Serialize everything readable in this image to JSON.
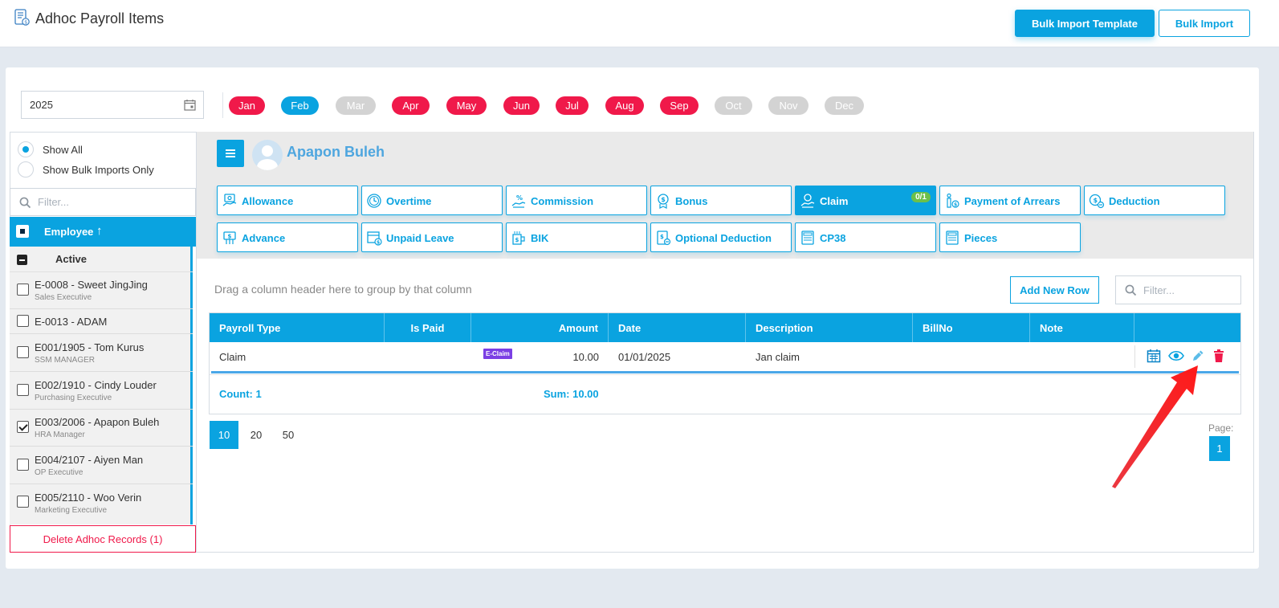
{
  "header": {
    "title": "Adhoc Payroll Items",
    "bulk_template_label": "Bulk Import Template",
    "bulk_import_label": "Bulk Import"
  },
  "year": {
    "value": "2025"
  },
  "months": [
    {
      "label": "Jan",
      "state": "red"
    },
    {
      "label": "Feb",
      "state": "blue"
    },
    {
      "label": "Mar",
      "state": "gray"
    },
    {
      "label": "Apr",
      "state": "red"
    },
    {
      "label": "May",
      "state": "red"
    },
    {
      "label": "Jun",
      "state": "red"
    },
    {
      "label": "Jul",
      "state": "red"
    },
    {
      "label": "Aug",
      "state": "red"
    },
    {
      "label": "Sep",
      "state": "red"
    },
    {
      "label": "Oct",
      "state": "gray"
    },
    {
      "label": "Nov",
      "state": "gray"
    },
    {
      "label": "Dec",
      "state": "gray"
    }
  ],
  "sidebar": {
    "show_all": "Show All",
    "show_bulk": "Show Bulk Imports Only",
    "filter_placeholder": "Filter...",
    "column_header": "Employee",
    "sort_arrow": "↑",
    "group_label": "Active",
    "employees": [
      {
        "name": "E-0008 - Sweet JingJing",
        "role": "Sales Executive",
        "checked": false
      },
      {
        "name": "E-0013 - ADAM",
        "role": "",
        "checked": false
      },
      {
        "name": "E001/1905 - Tom Kurus",
        "role": "SSM MANAGER",
        "checked": false
      },
      {
        "name": "E002/1910 - Cindy Louder",
        "role": "Purchasing Executive",
        "checked": false
      },
      {
        "name": "E003/2006 - Apapon Buleh",
        "role": "HRA Manager",
        "checked": true
      },
      {
        "name": "E004/2107 - Aiyen Man",
        "role": "OP Executive",
        "checked": false
      },
      {
        "name": "E005/2110 - Woo Verin",
        "role": "Marketing Executive",
        "checked": false
      }
    ],
    "delete_label": "Delete Adhoc Records (1)"
  },
  "main": {
    "employee_name": "Apapon Buleh",
    "categories_row1": [
      {
        "label": "Allowance",
        "icon": "allowance-icon"
      },
      {
        "label": "Overtime",
        "icon": "overtime-icon"
      },
      {
        "label": "Commission",
        "icon": "commission-icon"
      },
      {
        "label": "Bonus",
        "icon": "bonus-icon"
      },
      {
        "label": "Claim",
        "icon": "claim-icon",
        "badge": "0/1",
        "active": true
      },
      {
        "label": "Payment of Arrears",
        "icon": "arrears-icon"
      },
      {
        "label": "Deduction",
        "icon": "deduction-icon"
      }
    ],
    "categories_row2": [
      {
        "label": "Advance",
        "icon": "advance-icon"
      },
      {
        "label": "Unpaid Leave",
        "icon": "calendar-icon"
      },
      {
        "label": "BIK",
        "icon": "bik-icon"
      },
      {
        "label": "Optional Deduction",
        "icon": "optional-deduction-icon"
      },
      {
        "label": "CP38",
        "icon": "document-icon"
      },
      {
        "label": "Pieces",
        "icon": "document-icon"
      }
    ],
    "drag_hint": "Drag a column header here to group by that column",
    "add_row_label": "Add New Row",
    "filter_placeholder": "Filter...",
    "columns": [
      "Payroll Type",
      "Is Paid",
      "Amount",
      "Date",
      "Description",
      "BillNo",
      "Note"
    ],
    "rows": [
      {
        "payroll_type": "Claim",
        "is_paid": "",
        "tag": "E-Claim",
        "amount": "10.00",
        "date": "01/01/2025",
        "description": "Jan claim",
        "billno": "",
        "note": ""
      }
    ],
    "footer": {
      "count": "Count: 1",
      "sum": "Sum: 10.00"
    },
    "page_sizes": [
      "10",
      "20",
      "50"
    ],
    "page_label": "Page:",
    "current_page": "1"
  },
  "colors": {
    "accent": "#0aa3e0",
    "month_red": "#f0194a",
    "month_gray": "#d3d3d3",
    "eclaim_tag": "#7b3fe4",
    "annotation_arrow": "#e8141e"
  }
}
